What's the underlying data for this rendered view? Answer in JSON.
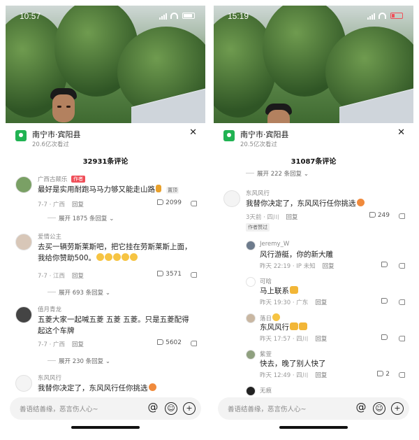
{
  "left": {
    "status_time": "10:57",
    "location": {
      "name": "南宁市·宾阳县",
      "views": "20.6亿次看过"
    },
    "comment_count": "32931条评论",
    "comments": [
      {
        "user": "广西古颠乐",
        "author_tag": "作者",
        "text": "最好是实用耐跑马马力够又能走山路",
        "gift": "置顶",
        "time": "7-7 · 广西",
        "likes": "2099"
      },
      {
        "expand": "展开 1875 条回复"
      },
      {
        "user": "爱情公主",
        "text": "去买一辆劳斯莱斯吧，把它挂在劳斯莱斯上面，我给你赞助500。",
        "time": "7-7 · 江西",
        "likes": "3571"
      },
      {
        "expand": "展开 693 条回复"
      },
      {
        "user": "值月青龙",
        "text": "五菱大家一起喊五菱 五菱 五菱。只是五菱配得起这个车牌",
        "time": "7-7 · 广西",
        "likes": "5602"
      },
      {
        "expand": "展开 230 条回复"
      },
      {
        "user": "东风风行",
        "text": "我替你决定了，东风风行任你挑选"
      }
    ],
    "input_placeholder": "善语结善缘，恶言伤人心~"
  },
  "right": {
    "status_time": "15:19",
    "location": {
      "name": "南宁市·宾阳县",
      "views": "20.5亿次看过"
    },
    "comment_count": "31087条评论",
    "comments": [
      {
        "expand": "展开 222 条回复"
      },
      {
        "user": "东风风行",
        "text": "我替你决定了，东风风行任你挑选",
        "time": "3天前 · 四川",
        "reply": "回复",
        "likes": "249",
        "liked_tag": "作者赞过"
      },
      {
        "user": "Jeremy_W",
        "text": "风行游艇，你的新大雕",
        "time": "昨天 22:19 · IP 未知",
        "reply": "回复"
      },
      {
        "user": "可晗",
        "text": "马上联系",
        "time": "昨天 19:30 · 广东",
        "reply": "回复"
      },
      {
        "user": "落日",
        "text": "东风风行",
        "time": "昨天 17:57 · 四川",
        "reply": "回复"
      },
      {
        "user": "紫萱",
        "text": "快去，晚了别人快了",
        "time": "昨天 12:49 · 四川",
        "reply": "回复",
        "likes": "2"
      },
      {
        "user": "无痕"
      }
    ],
    "input_placeholder": "善语结善缘，恶言伤人心~"
  },
  "common": {
    "reply": "回复",
    "close": "✕",
    "at": "@"
  },
  "colors": {
    "location_green": "#21b353",
    "author_red": "#f04f59"
  }
}
